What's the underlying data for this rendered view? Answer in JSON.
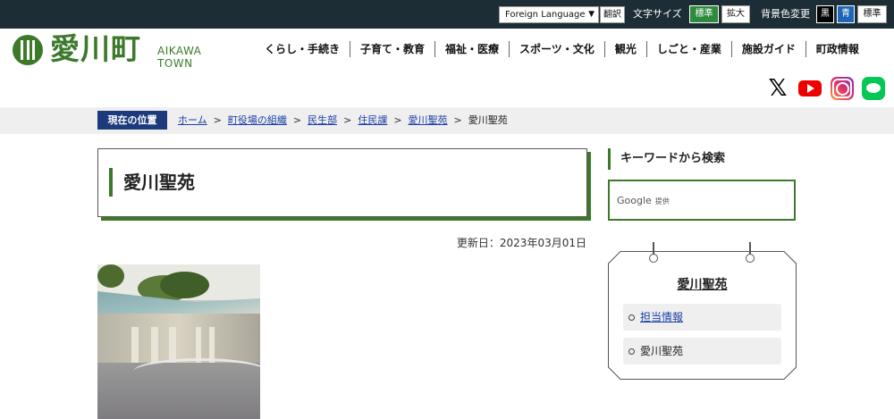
{
  "topbar": {
    "language_select": "Foreign Language",
    "translate": "翻訳",
    "font_size_label": "文字サイズ",
    "font_size_standard": "標準",
    "font_size_large": "拡大",
    "bg_color_label": "背景色変更",
    "bg_black": "黒",
    "bg_blue": "青",
    "bg_standard": "標準"
  },
  "header": {
    "logo_jp": "愛川町",
    "logo_en": "AIKAWA TOWN",
    "nav": [
      "くらし・手続き",
      "子育て・教育",
      "福祉・医療",
      "スポーツ・文化",
      "観光",
      "しごと・産業",
      "施設ガイド",
      "町政情報"
    ]
  },
  "sns": {
    "x": "X",
    "youtube": "YouTube",
    "instagram": "Instagram",
    "line": "LINE"
  },
  "breadcrumb": {
    "label": "現在の位置",
    "items": [
      "ホーム",
      "町役場の組織",
      "民生部",
      "住民課",
      "愛川聖苑"
    ],
    "current": "愛川聖苑",
    "separator": ">"
  },
  "main": {
    "title": "愛川聖苑",
    "updated": "更新日：2023年03月01日"
  },
  "sidebar": {
    "keyword_heading": "キーワードから検索",
    "search_brand": "Google",
    "search_provided": "提供",
    "menu_title": "愛川聖苑",
    "menu_items": [
      "担当情報",
      "愛川聖苑"
    ]
  },
  "colors": {
    "brand_green": "#3c7a2a",
    "topbar_bg": "#1d2d35",
    "breadcrumb_label_bg": "#1c3a7c",
    "link": "#1a3fa8"
  }
}
